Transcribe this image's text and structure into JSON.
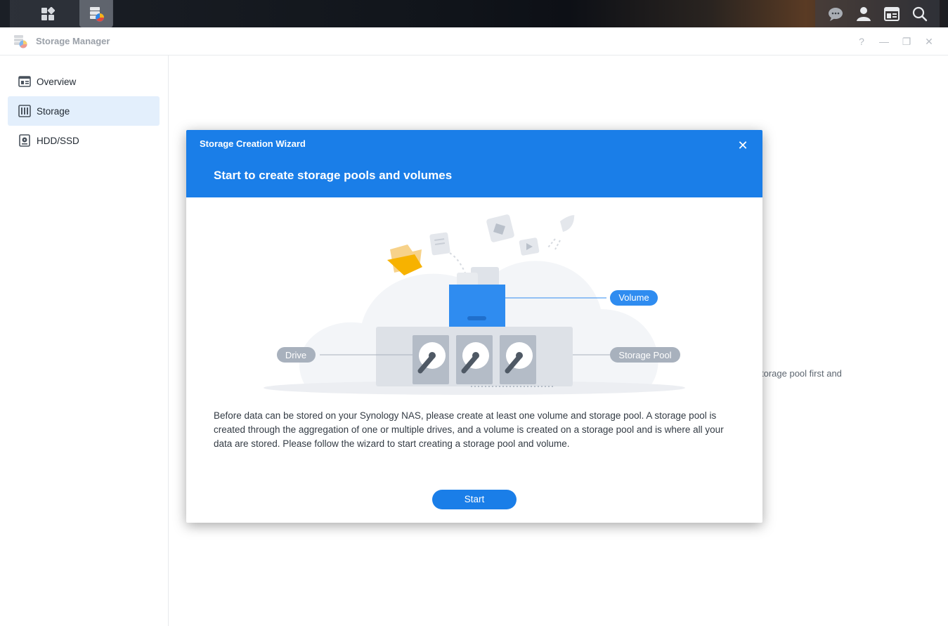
{
  "taskbar": {
    "left_icons": [
      "main-menu-icon",
      "storage-manager-app-icon"
    ],
    "right_icons": [
      "notification-icon",
      "user-icon",
      "widgets-icon",
      "search-icon"
    ]
  },
  "window": {
    "title": "Storage Manager",
    "controls": {
      "help": "?",
      "minimize": "—",
      "restore": "❐",
      "close": "✕"
    }
  },
  "sidebar": {
    "items": [
      {
        "label": "Overview",
        "icon": "overview-icon",
        "selected": false
      },
      {
        "label": "Storage",
        "icon": "storage-icon",
        "selected": true
      },
      {
        "label": "HDD/SSD",
        "icon": "hdd-icon",
        "selected": false
      }
    ]
  },
  "background_text": "torage pool first and",
  "wizard": {
    "title": "Storage Creation Wizard",
    "heading": "Start to create storage pools and volumes",
    "close": "✕",
    "illustration": {
      "volume_label": "Volume",
      "drive_label": "Drive",
      "storage_pool_label": "Storage Pool"
    },
    "description": "Before data can be stored on your Synology NAS, please create at least one volume and storage pool. A storage pool is created through the aggregation of one or multiple drives, and a volume is created on a storage pool and is where all your data are stored. Please follow the wizard to start creating a storage pool and volume.",
    "start_button": "Start",
    "colors": {
      "accent": "#1a7ee8",
      "header_bg": "#1a7ee8"
    }
  }
}
